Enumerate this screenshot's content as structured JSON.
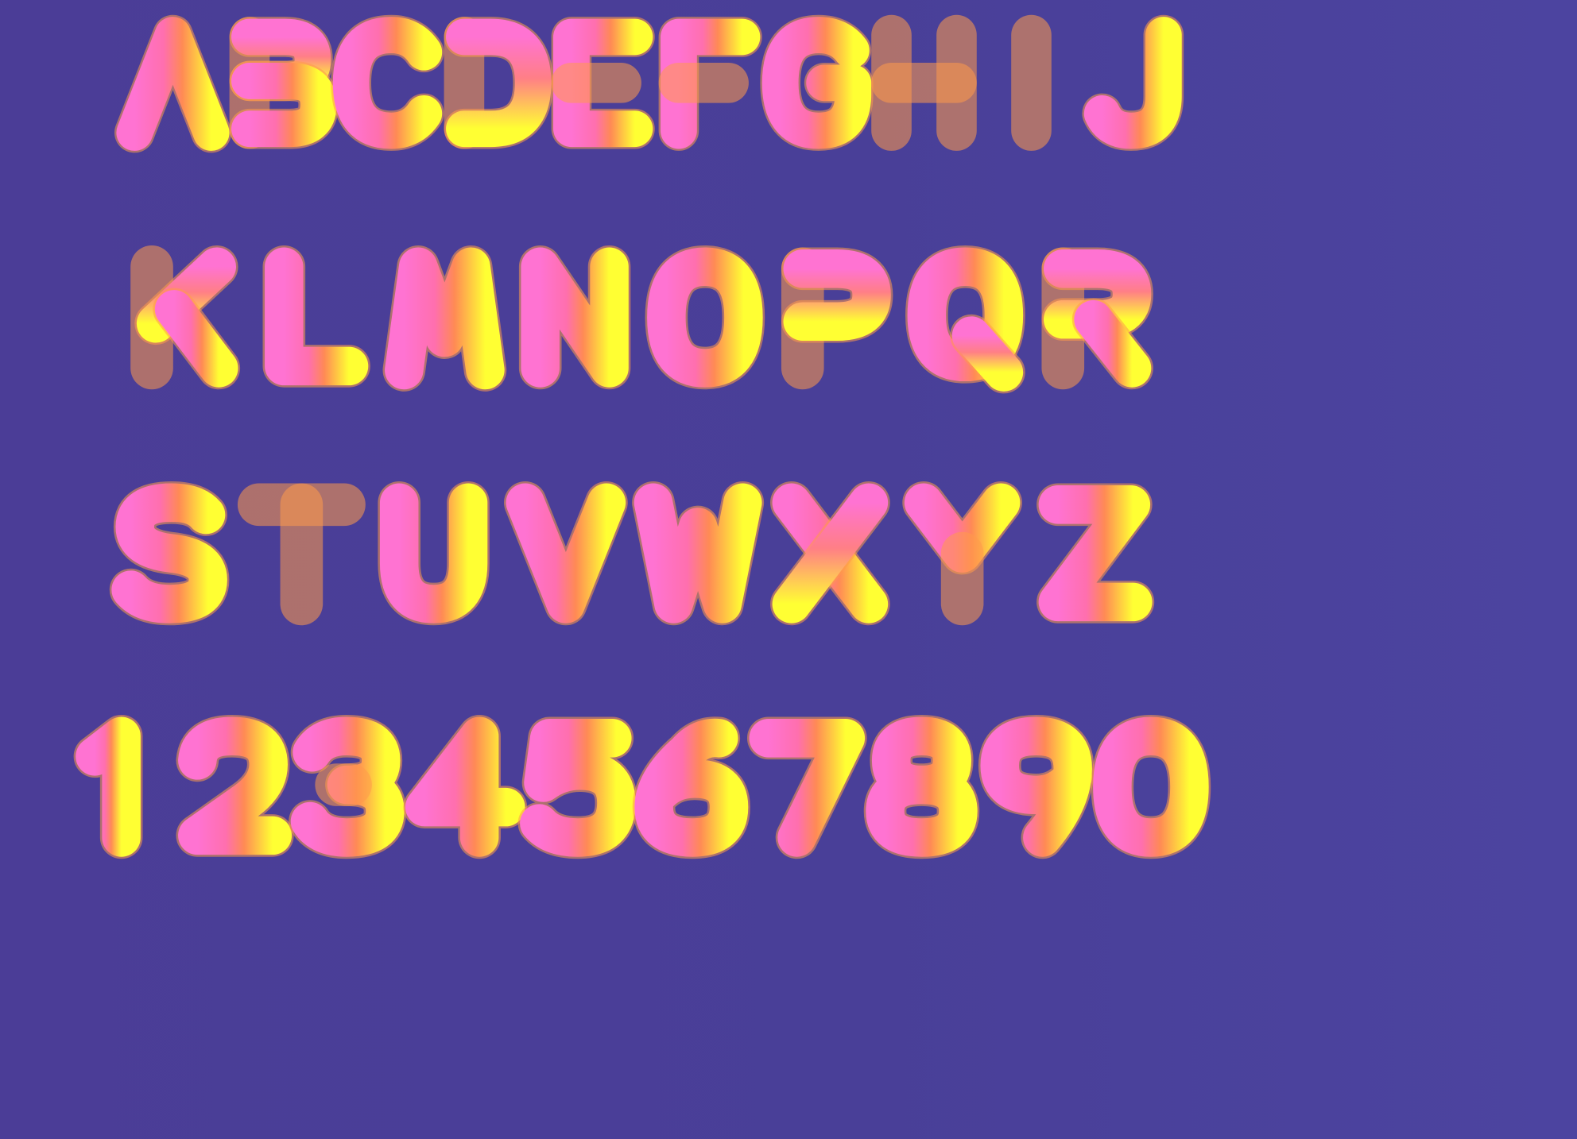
{
  "rows": [
    [
      "A",
      "B",
      "C",
      "D",
      "E",
      "F",
      "G",
      "H",
      "I",
      "J"
    ],
    [
      "K",
      "L",
      "M",
      "N",
      "O",
      "P",
      "Q",
      "R"
    ],
    [
      "S",
      "T",
      "U",
      "V",
      "W",
      "X",
      "Y",
      "Z"
    ],
    [
      "1",
      "2",
      "3",
      "4",
      "5",
      "6",
      "7",
      "8",
      "9",
      "0"
    ]
  ],
  "colors": {
    "background": "#4a3f99",
    "glyph_pink": "#ff73d2",
    "glyph_orange": "#ff8a55",
    "glyph_yellow": "#ffff33"
  }
}
